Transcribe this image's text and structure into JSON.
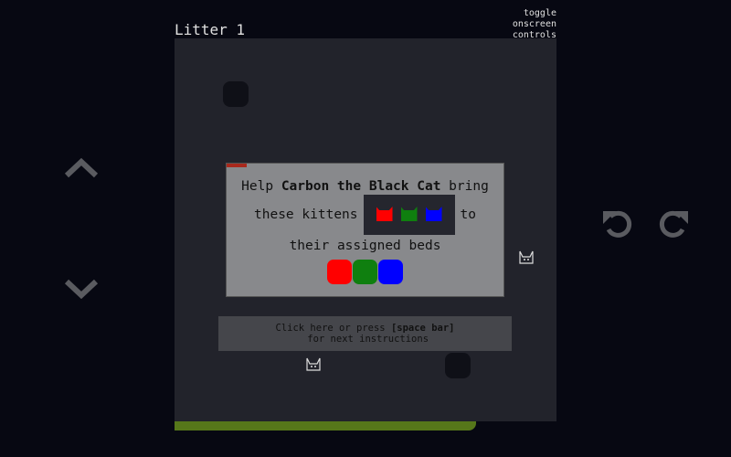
{
  "header": {
    "title": "Litter 1",
    "toggle_label": "toggle onscreen controls"
  },
  "dialog": {
    "text_pre": "Help ",
    "text_bold": "Carbon the Black Cat",
    "text_post": " bring",
    "line2_pre": "these kittens",
    "line2_post": "to",
    "line3": "their assigned beds"
  },
  "kittens": [
    {
      "color": "#ff0000"
    },
    {
      "color": "#0f7f0f"
    },
    {
      "color": "#0000ff"
    }
  ],
  "beds": [
    "#ff0000",
    "#0f7f0f",
    "#0000ff"
  ],
  "next": {
    "pre": "Click here or press ",
    "key": "[space bar]",
    "post": " for next instructions"
  },
  "progress": {
    "fraction": 0.79,
    "color": "#56771a"
  },
  "controls": {
    "up": "chevron-up",
    "down": "chevron-down",
    "undo": "undo",
    "redo": "redo"
  }
}
